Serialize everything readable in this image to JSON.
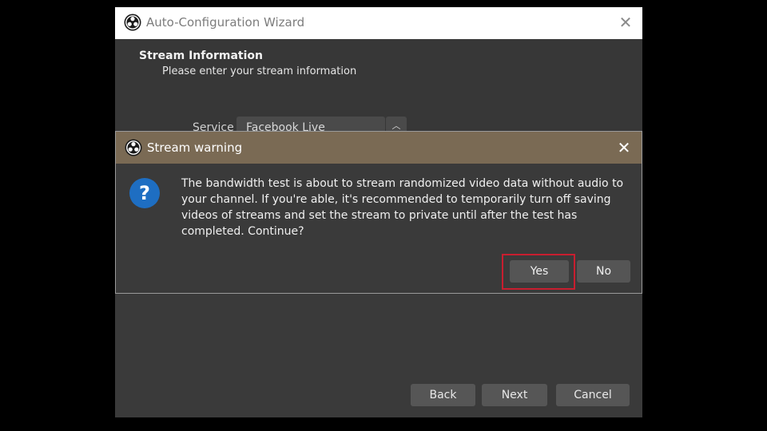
{
  "wizard": {
    "title": "Auto-Configuration Wizard",
    "close_icon": "close-icon",
    "section_title": "Stream Information",
    "section_subtitle": "Please enter your stream information",
    "service_label": "Service",
    "service_value": "Facebook Live",
    "buttons": {
      "back": "Back",
      "next": "Next",
      "cancel": "Cancel"
    }
  },
  "dialog": {
    "title": "Stream warning",
    "icon": "question-icon",
    "icon_glyph": "?",
    "message": "The bandwidth test is about to stream randomized video data without audio to your channel. If you're able, it's recommended to temporarily turn off saving videos of streams and set the stream to private until after the test has completed. Continue?",
    "buttons": {
      "yes": "Yes",
      "no": "No"
    },
    "highlight_color": "#c81e2f",
    "titlebar_color": "#7a6a54"
  }
}
